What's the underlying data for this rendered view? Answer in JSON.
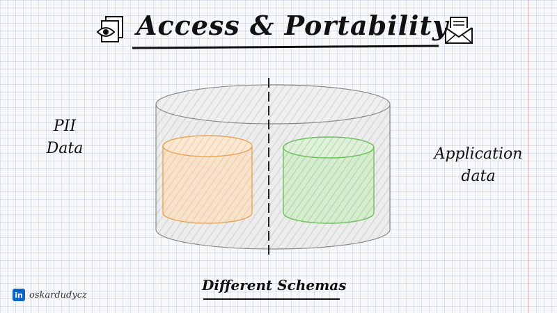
{
  "title": "Access & Portability",
  "labels": {
    "left": [
      "PII",
      "Data"
    ],
    "right": [
      "Application",
      "data"
    ],
    "bottom": "Different Schemas"
  },
  "author": {
    "network": "in",
    "handle": "oskardudycz"
  },
  "colors": {
    "ink": "#111111",
    "outer_cylinder": "#bdbdbd",
    "pii_db": "#e8a65a",
    "app_db": "#6fbf5f",
    "linkedin": "#0a66c2"
  },
  "icons": {
    "left": "document-eye-icon",
    "right": "envelope-letter-icon"
  }
}
